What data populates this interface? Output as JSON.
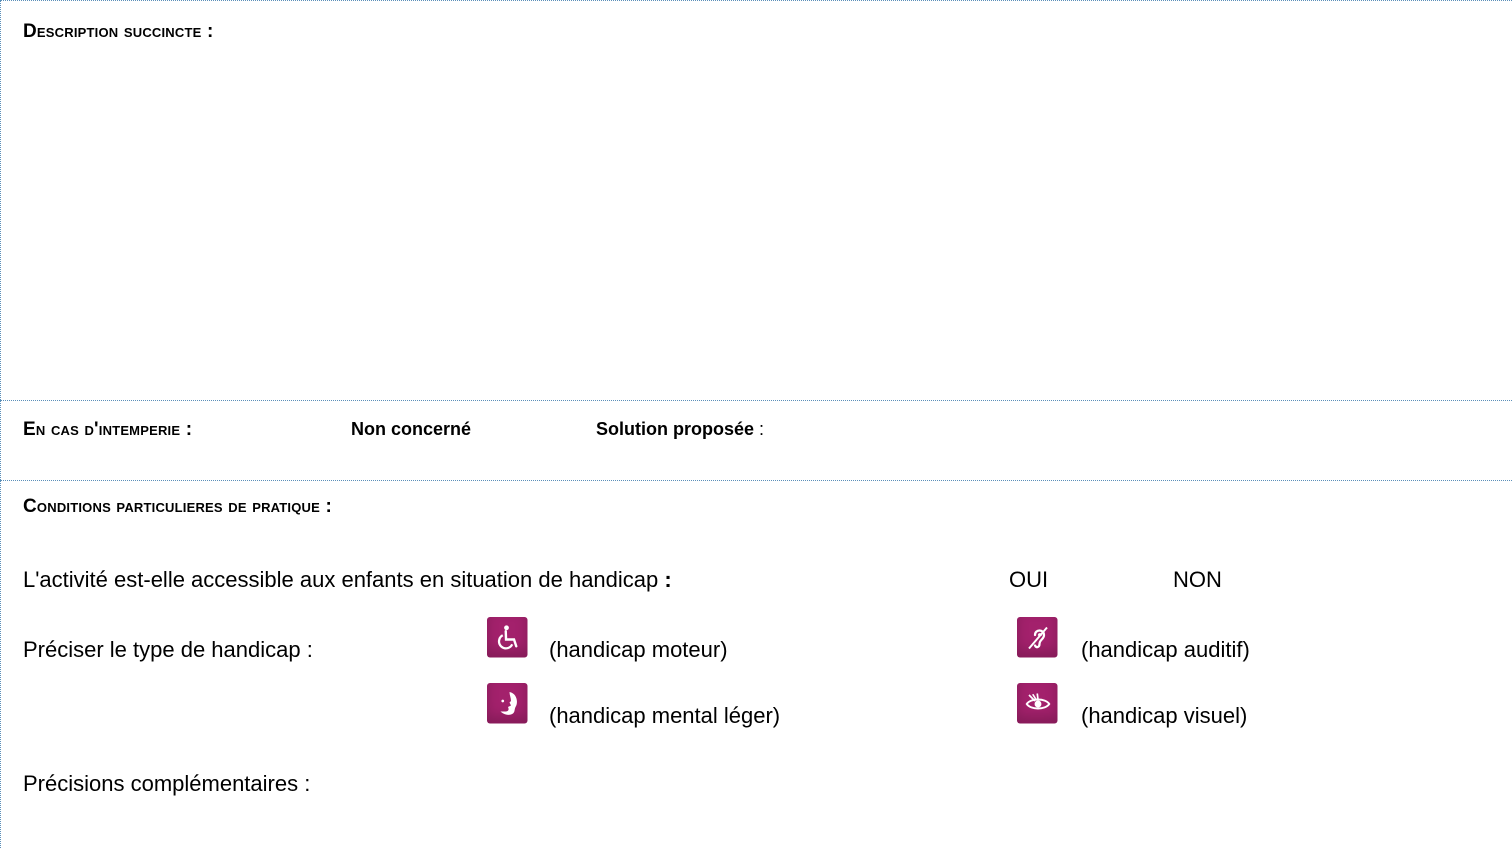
{
  "description": {
    "title": "Description succincte :",
    "content": ""
  },
  "weather": {
    "title": "En cas d'intemperie :",
    "option_not_concerned": "Non concerné",
    "option_solution_label": "Solution proposée",
    "option_solution_colon": " :"
  },
  "conditions": {
    "title": "Conditions particulieres de pratique :",
    "accessible_question": "L'activité est-elle accessible aux enfants en situation de handicap",
    "accessible_question_colon": " :",
    "yes_label": "OUI",
    "no_label": "NON",
    "type_label": "Préciser le type de handicap :",
    "handicaps": [
      {
        "icon": "wheelchair-icon",
        "label": "(handicap moteur)"
      },
      {
        "icon": "hearing-icon",
        "label": "(handicap auditif)"
      },
      {
        "icon": "mental-icon",
        "label": "(handicap mental léger)"
      },
      {
        "icon": "eye-icon",
        "label": "(handicap visuel)"
      }
    ],
    "extra_label": "Précisions complémentaires :"
  },
  "colors": {
    "icon_background": "#a3216c",
    "border": "#5b8fb9"
  }
}
